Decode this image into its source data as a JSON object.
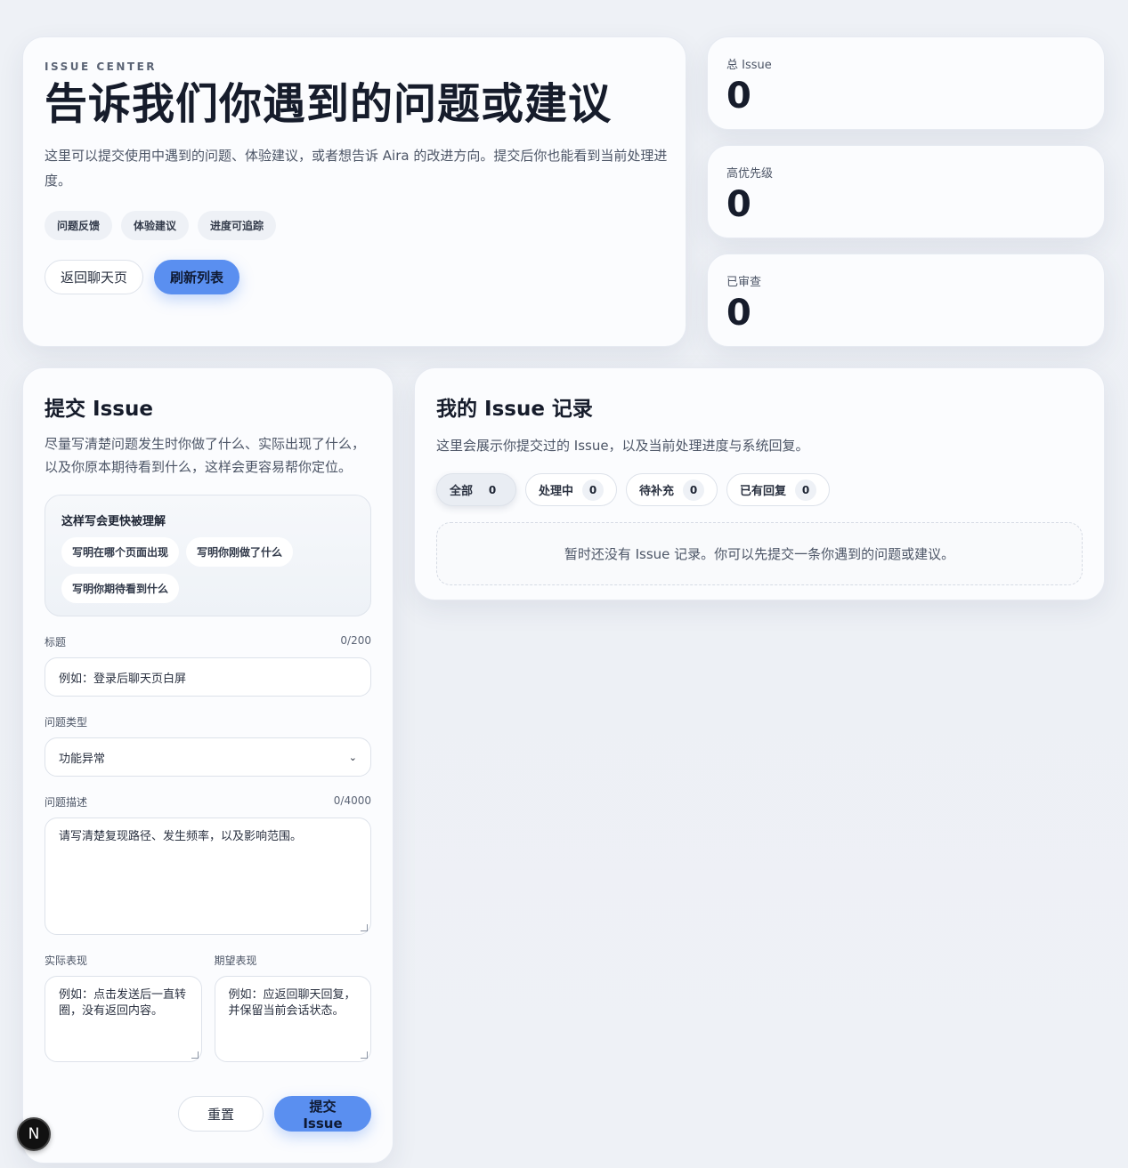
{
  "hero": {
    "eyebrow": "ISSUE CENTER",
    "title": "告诉我们你遇到的问题或建议",
    "description": "这里可以提交使用中遇到的问题、体验建议，或者想告诉 Aira 的改进方向。提交后你也能看到当前处理进度。",
    "tags": [
      "问题反馈",
      "体验建议",
      "进度可追踪"
    ],
    "back_button": "返回聊天页",
    "refresh_button": "刷新列表"
  },
  "stats": [
    {
      "label": "总 Issue",
      "value": "0"
    },
    {
      "label": "高优先级",
      "value": "0"
    },
    {
      "label": "已审查",
      "value": "0"
    }
  ],
  "submit": {
    "title": "提交 Issue",
    "description": "尽量写清楚问题发生时你做了什么、实际出现了什么，以及你原本期待看到什么，这样会更容易帮你定位。",
    "tips_title": "这样写会更快被理解",
    "tips": [
      "写明在哪个页面出现",
      "写明你刚做了什么",
      "写明你期待看到什么"
    ],
    "title_label": "标题",
    "title_counter": "0/200",
    "title_placeholder": "例如：登录后聊天页白屏",
    "type_label": "问题类型",
    "type_value": "功能异常",
    "desc_label": "问题描述",
    "desc_counter": "0/4000",
    "desc_placeholder": "请写清楚复现路径、发生频率，以及影响范围。",
    "actual_label": "实际表现",
    "actual_placeholder": "例如：点击发送后一直转圈，没有返回内容。",
    "expected_label": "期望表现",
    "expected_placeholder": "例如：应返回聊天回复，并保留当前会话状态。",
    "reset_button": "重置",
    "submit_button": "提交 Issue"
  },
  "records": {
    "title": "我的 Issue 记录",
    "description": "这里会展示你提交过的 Issue，以及当前处理进度与系统回复。",
    "filters": [
      {
        "label": "全部",
        "count": "0"
      },
      {
        "label": "处理中",
        "count": "0"
      },
      {
        "label": "待补充",
        "count": "0"
      },
      {
        "label": "已有回复",
        "count": "0"
      }
    ],
    "empty_text": "暂时还没有 Issue 记录。你可以先提交一条你遇到的问题或建议。"
  },
  "devtools": {
    "badge": "N"
  },
  "colors": {
    "accent": "#5a8ff0",
    "background": "#eef1f6",
    "card": "#fbfcfe"
  }
}
